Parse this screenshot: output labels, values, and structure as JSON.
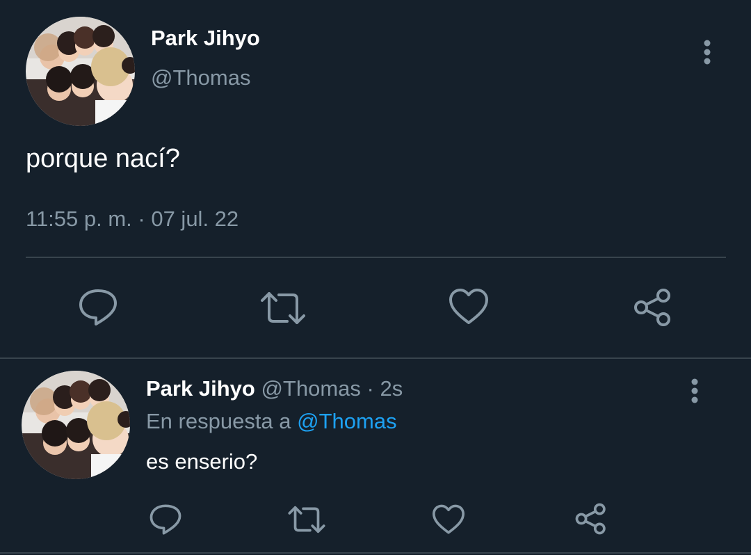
{
  "colors": {
    "background": "#15202b",
    "text": "#ffffff",
    "muted": "#8899a6",
    "link": "#1da1f2",
    "divider": "#38444d"
  },
  "main_tweet": {
    "author_name": "Park Jihyo",
    "author_handle": "@Thomas",
    "text": "porque nací?",
    "timestamp": "11:55 p. m. · 07 jul. 22",
    "more_icon": "more-vertical-icon",
    "actions": [
      "reply-icon",
      "retweet-icon",
      "like-icon",
      "share-icon"
    ]
  },
  "reply_tweet": {
    "author_name": "Park Jihyo",
    "author_handle": "@Thomas",
    "time_sep": "·",
    "age": "2s",
    "reply_prefix": "En respuesta a",
    "reply_to": "@Thomas",
    "text": "es enserio?",
    "more_icon": "more-vertical-icon",
    "actions": [
      "reply-icon",
      "retweet-icon",
      "like-icon",
      "share-icon"
    ]
  }
}
